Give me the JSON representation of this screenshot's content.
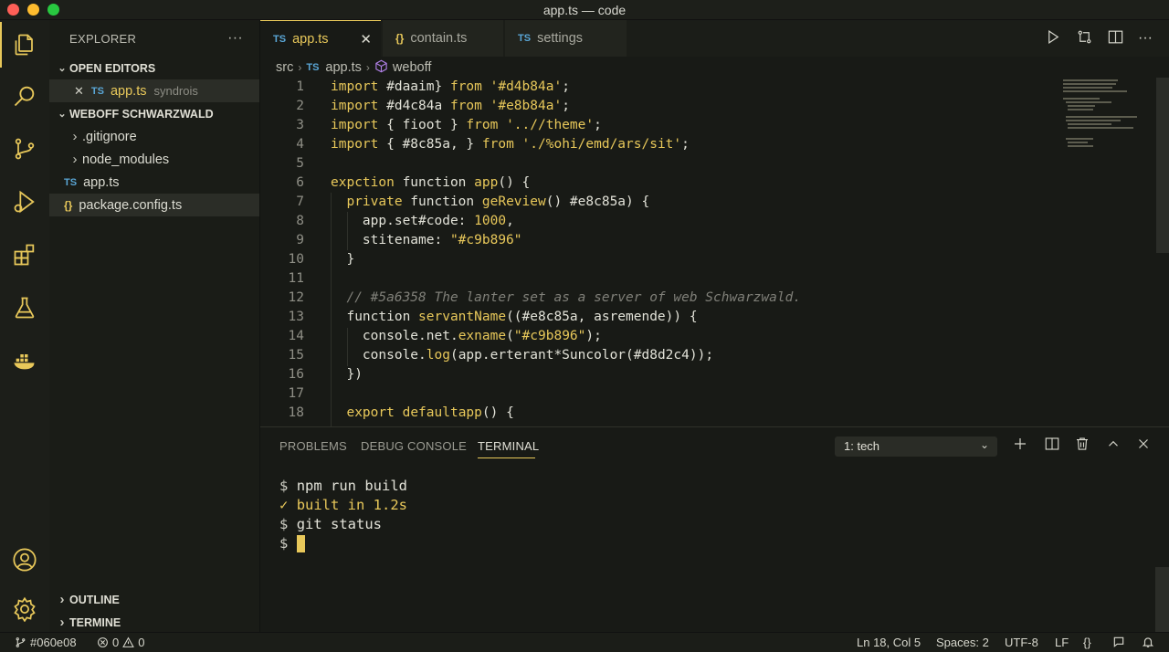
{
  "window": {
    "title": "app.ts — code"
  },
  "colors": {
    "accent": "#e8c85a",
    "ts_badge": "#5aa6d6",
    "background": "#181a16"
  },
  "activity_bar": {
    "items": [
      "files-icon",
      "search-icon",
      "source-control-icon",
      "run-debug-icon",
      "extensions-icon",
      "testing-icon",
      "docker-icon"
    ],
    "bottom": [
      "account-icon",
      "settings-gear-icon"
    ]
  },
  "sidebar": {
    "title": "EXPLORER",
    "more": "···",
    "open_editors": {
      "label": "OPEN EDITORS",
      "items": [
        {
          "badge": "TS",
          "name": "app.ts",
          "detail": "syndrois",
          "close": "✕"
        }
      ]
    },
    "workspace": {
      "label": "WEBOFF SCHWARZWALD",
      "items": [
        {
          "chevron": "›",
          "name": ".gitignore"
        },
        {
          "chevron": "›",
          "name": "node_modules"
        },
        {
          "badge": "TS",
          "name": "app.ts"
        },
        {
          "badge": "{}",
          "name": "package.config.ts"
        }
      ]
    },
    "outline": "OUTLINE",
    "timeline": "TERMINE"
  },
  "tabs": [
    {
      "badge": "TS",
      "label": "app.ts",
      "close": "✕"
    },
    {
      "badge": "{}",
      "label": "contain.ts"
    },
    {
      "badge": "TS",
      "label": "settings"
    }
  ],
  "breadcrumb": {
    "folder": "src",
    "badge": "TS",
    "file": "app.ts",
    "symbol": "weboff"
  },
  "editor": {
    "lines": [
      {
        "n": "1",
        "tokens": [
          [
            "kw",
            "import"
          ],
          [
            "txt",
            " #daaim} "
          ],
          [
            "kw",
            "from"
          ],
          [
            "str",
            " '#d4b84a'"
          ],
          [
            "txt",
            ";"
          ]
        ]
      },
      {
        "n": "2",
        "tokens": [
          [
            "kw",
            "import"
          ],
          [
            "txt",
            " #d4c84a "
          ],
          [
            "kw",
            "from"
          ],
          [
            "str",
            " '#e8b84a'"
          ],
          [
            "txt",
            ";"
          ]
        ]
      },
      {
        "n": "3",
        "tokens": [
          [
            "kw",
            "import"
          ],
          [
            "txt",
            " { fioot } "
          ],
          [
            "kw",
            "from"
          ],
          [
            "str",
            " '..//theme'"
          ],
          [
            "txt",
            ";"
          ]
        ]
      },
      {
        "n": "4",
        "tokens": [
          [
            "kw",
            "import"
          ],
          [
            "txt",
            " { #8c85a, } "
          ],
          [
            "kw",
            "from"
          ],
          [
            "str",
            " './%ohi/emd/ars/sit'"
          ],
          [
            "txt",
            ";"
          ]
        ]
      },
      {
        "n": "5",
        "tokens": []
      },
      {
        "n": "6",
        "tokens": [
          [
            "kw",
            "expction"
          ],
          [
            "txt",
            " function "
          ],
          [
            "fn",
            "app"
          ],
          [
            "txt",
            "() {"
          ]
        ]
      },
      {
        "n": "7",
        "tokens": [
          [
            "txt",
            "  "
          ],
          [
            "kw",
            "private"
          ],
          [
            "txt",
            " function "
          ],
          [
            "fn",
            "geReview"
          ],
          [
            "txt",
            "() #e8c85a) {"
          ]
        ]
      },
      {
        "n": "8",
        "tokens": [
          [
            "txt",
            "    app.set#code: "
          ],
          [
            "str",
            "1000"
          ],
          [
            "txt",
            ","
          ]
        ]
      },
      {
        "n": "9",
        "tokens": [
          [
            "txt",
            "    stitename: "
          ],
          [
            "str",
            "\"#c9b896\""
          ]
        ]
      },
      {
        "n": "10",
        "tokens": [
          [
            "txt",
            "  }"
          ]
        ]
      },
      {
        "n": "11",
        "tokens": []
      },
      {
        "n": "12",
        "tokens": [
          [
            "txt",
            "  "
          ],
          [
            "cm",
            "// #5a6358 The lanter set as a server of web Schwarzwald."
          ]
        ]
      },
      {
        "n": "13",
        "tokens": [
          [
            "txt",
            "  function "
          ],
          [
            "fn",
            "servantName"
          ],
          [
            "txt",
            "((#e8c85a, asremende)) {"
          ]
        ]
      },
      {
        "n": "14",
        "tokens": [
          [
            "txt",
            "    console.net."
          ],
          [
            "fn",
            "exname"
          ],
          [
            "txt",
            "("
          ],
          [
            "str",
            "\"#c9b896\""
          ],
          [
            "txt",
            ");"
          ]
        ]
      },
      {
        "n": "15",
        "tokens": [
          [
            "txt",
            "    console."
          ],
          [
            "fn",
            "log"
          ],
          [
            "txt",
            "(app.erterant*Suncolor(#d8d2c4));"
          ]
        ]
      },
      {
        "n": "16",
        "tokens": [
          [
            "txt",
            "  })"
          ]
        ]
      },
      {
        "n": "17",
        "tokens": []
      },
      {
        "n": "18",
        "tokens": [
          [
            "txt",
            "  "
          ],
          [
            "kw",
            "export"
          ],
          [
            "txt",
            " "
          ],
          [
            "fn",
            "defaultapp"
          ],
          [
            "txt",
            "() {"
          ]
        ]
      }
    ]
  },
  "panel": {
    "tabs": [
      "PROBLEMS",
      "DEBUG CONSOLE",
      "TERMINAL"
    ],
    "terminal_select": "1: tech",
    "terminal_lines": [
      {
        "prompt": "$",
        "text": "npm run build"
      },
      {
        "prompt": "✓",
        "text": "built in 1.2s"
      },
      {
        "prompt": "$",
        "text": "git status"
      },
      {
        "prompt": "$",
        "text": ""
      }
    ]
  },
  "status_bar": {
    "branch": "#060e08",
    "errors": "0",
    "warnings": "0",
    "position": "Ln 18, Col 5",
    "spaces": "Spaces: 2",
    "encoding": "UTF-8",
    "eol": "LF",
    "language": "{}"
  }
}
